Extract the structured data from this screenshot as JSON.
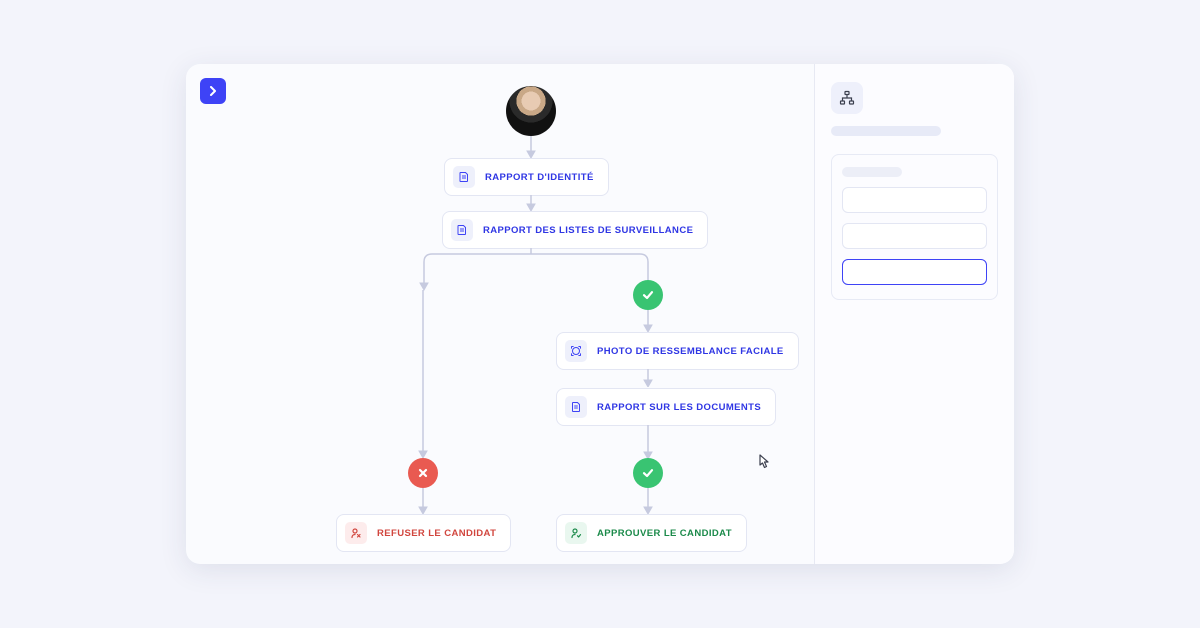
{
  "flow": {
    "identity_report": "RAPPORT D'IDENTITÉ",
    "watchlist_report": "RAPPORT DES LISTES DE SURVEILLANCE",
    "facial_match": "PHOTO DE RESSEMBLANCE FACIALE",
    "document_report": "RAPPORT SUR LES DOCUMENTS",
    "approve": "APPROUVER LE CANDIDAT",
    "reject": "REFUSER LE CANDIDAT"
  },
  "icons": {
    "expand": "chevron-right-icon",
    "flowchart": "flowchart-icon",
    "report": "report-icon",
    "camera": "face-match-icon",
    "document": "document-icon",
    "user_ok": "user-approve-icon",
    "user_x": "user-reject-icon",
    "check": "check-circle-icon",
    "cross": "cross-circle-icon",
    "cursor": "pointer-cursor-icon"
  },
  "colors": {
    "accent": "#3e43f6",
    "success": "#39c472",
    "danger": "#e95a51"
  }
}
